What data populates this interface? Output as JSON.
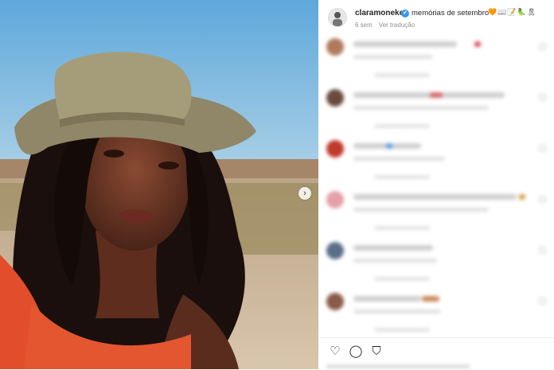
{
  "post": {
    "username": "claramoneke",
    "caption": "memórias de setembro",
    "caption_emojis": "🧡📖📝🦜🎗",
    "time_ago": "6 sem",
    "translate_label": "Ver tradução",
    "verified_mark": "✔"
  },
  "media": {
    "next_arrow": "›"
  },
  "actions": {
    "like_icon": "♡",
    "comment_icon": "◯",
    "share_icon": "⛉"
  },
  "colors": {
    "verified_blue": "#3897f0",
    "text_primary": "#262626",
    "text_secondary": "#8e8e8e"
  }
}
